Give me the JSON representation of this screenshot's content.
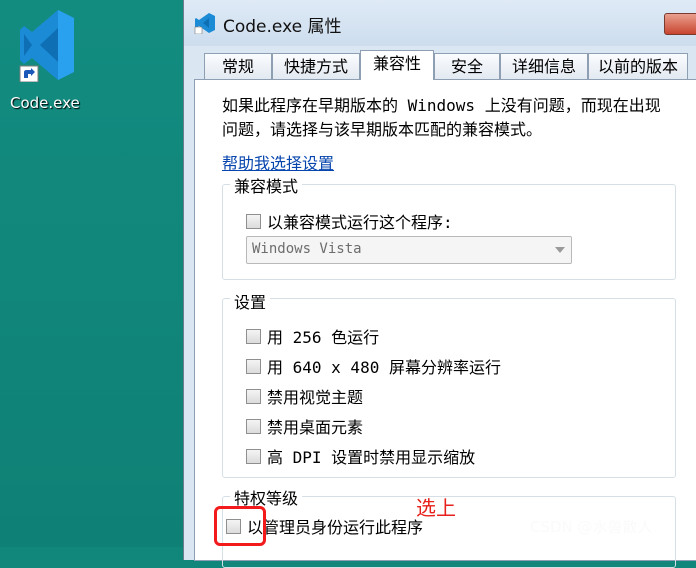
{
  "desktop": {
    "icon_label": "Code.exe",
    "icon_name": "vscode-icon"
  },
  "dialog": {
    "title": "Code.exe 属性",
    "tabs": [
      {
        "label": "常规",
        "active": false
      },
      {
        "label": "快捷方式",
        "active": false
      },
      {
        "label": "兼容性",
        "active": true
      },
      {
        "label": "安全",
        "active": false
      },
      {
        "label": "详细信息",
        "active": false
      },
      {
        "label": "以前的版本",
        "active": false
      }
    ],
    "description": "如果此程序在早期版本的 Windows 上没有问题，而现在出现问题，请选择与该早期版本匹配的兼容模式。",
    "help_link": "帮助我选择设置",
    "compat_group": {
      "title": "兼容模式",
      "checkbox": {
        "label": "以兼容模式运行这个程序:",
        "checked": false
      },
      "select_value": "Windows Vista"
    },
    "settings_group": {
      "title": "设置",
      "options": [
        {
          "label": "用 256 色运行",
          "checked": false
        },
        {
          "label": "用 640 x 480 屏幕分辨率运行",
          "checked": false
        },
        {
          "label": "禁用视觉主题",
          "checked": false
        },
        {
          "label": "禁用桌面元素",
          "checked": false
        },
        {
          "label": "高 DPI 设置时禁用显示缩放",
          "checked": false
        }
      ]
    },
    "privilege_group": {
      "title": "特权等级",
      "checkbox": {
        "label": "以管理员身份运行此程序",
        "checked": false
      }
    }
  },
  "annotation": {
    "text": "选上",
    "color": "#e8201b"
  },
  "watermark": "CSDN @水兽散人",
  "colors": {
    "desktop": "#11877b",
    "link": "#0645ad",
    "highlight": "#f21a1a"
  }
}
